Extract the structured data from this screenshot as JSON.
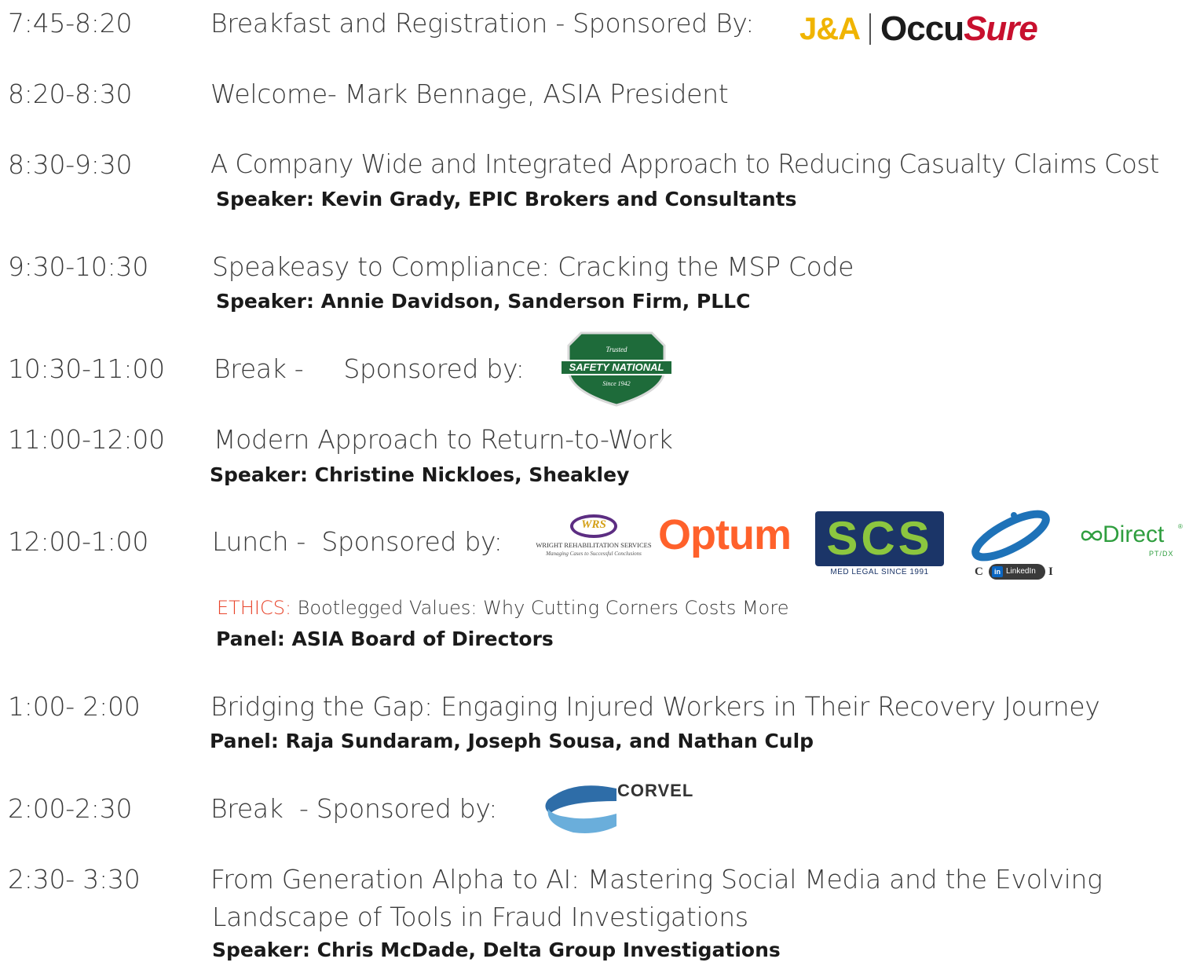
{
  "sessions": [
    {
      "time": "7:45-8:20",
      "title": "Breakfast and Registration - Sponsored  By:"
    },
    {
      "time": "8:20-8:30",
      "title": "Welcome- Mark Bennage, ASIA President"
    },
    {
      "time": "8:30-9:30",
      "title": "A Company Wide and Integrated Approach to Reducing Casualty Claims Cost",
      "speaker": "Speaker: Kevin Grady, EPIC Brokers and Consultants"
    },
    {
      "time": "9:30-10:30",
      "title": "Speakeasy to Compliance: Cracking the MSP Code",
      "speaker": "Speaker:  Annie Davidson, Sanderson Firm, PLLC"
    },
    {
      "time": "10:30-11:00",
      "title": "Break -     Sponsored by:"
    },
    {
      "time": "11:00-12:00",
      "title": "Modern Approach to Return-to-Work",
      "speaker": "Speaker: Christine Nickloes, Sheakley"
    },
    {
      "time": "12:00-1:00",
      "title": "Lunch -  Sponsored by:"
    },
    {
      "time": "1:00- 2:00",
      "title": "Bridging the Gap: Engaging Injured Workers in Their Recovery Journey",
      "speaker": "Panel: Raja Sundaram, Joseph Sousa, and Nathan Culp"
    },
    {
      "time": "2:00-2:30",
      "title": "Break  - Sponsored by:"
    },
    {
      "time": "2:30- 3:30",
      "title": "From Generation Alpha to AI: Mastering Social Media and the Evolving",
      "title2": "Landscape of Tools in Fraud Investigations",
      "speaker": "Speaker: Chris McDade, Delta Group Investigations"
    }
  ],
  "ethics": {
    "label": "ETHICS:",
    "title": " Bootlegged Values: Why Cutting Corners Costs More",
    "panel": "Panel: ASIA Board of Directors"
  },
  "logos": {
    "ja": "J&A",
    "occu": "Occu",
    "occu_sure": "Sure",
    "safety_top": "Trusted",
    "safety_name": "SAFETY NATIONAL",
    "safety_bottom": "Since 1942",
    "wrs": "WRS",
    "wrs_name": "WRIGHT REHABILITATION SERVICES",
    "wrs_tagline": "Managing Cases to Successful Conclusions",
    "optum": "Optum",
    "scs": "SCS",
    "scs_tagline": "MED LEGAL SINCE 1991",
    "cci_left": "C",
    "cci_right": "I",
    "linkedin_in": "in",
    "linkedin_text": "LinkedIn",
    "direct": "Direct",
    "direct_sub": "PT/DX",
    "corvel": "CORVEL"
  },
  "colors": {
    "ethics_red": "#e8452c",
    "ja_gold": "#f0b400",
    "occusure_red": "#c8102e",
    "safety_green": "#1e6b3a",
    "optum_orange": "#ff612b",
    "scs_green": "#8cc63f",
    "scs_navy": "#1b3568",
    "cci_blue": "#1e72b8",
    "direct_green": "#2f9e3f",
    "corvel_blue": "#4a8cc7"
  }
}
